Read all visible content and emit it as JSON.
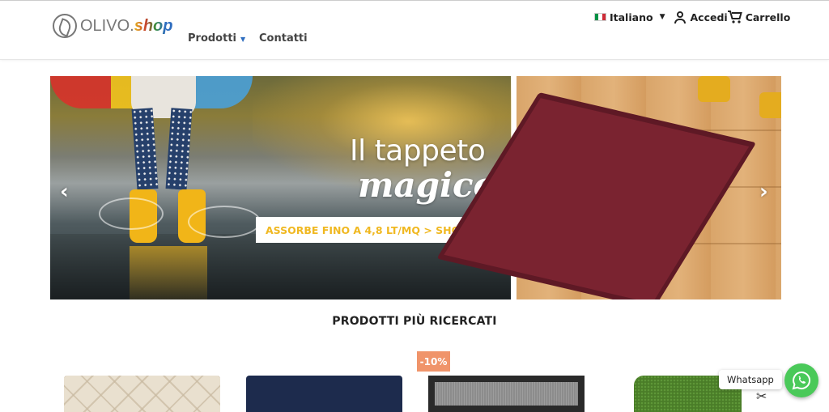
{
  "header": {
    "logo": {
      "text_main": "OLIVO.",
      "text_accent": "shop"
    },
    "nav": [
      {
        "label": "Prodotti",
        "has_dropdown": true
      },
      {
        "label": "Contatti",
        "has_dropdown": false
      }
    ],
    "language": {
      "label": "Italiano",
      "flag": "italy-flag-icon"
    },
    "account_label": "Accedi",
    "cart_label": "Carrello"
  },
  "hero": {
    "title_line1": "Il tappeto",
    "title_line2": "magico",
    "cta": "ASSORBE FINO A 4,8 LT/MQ > SHOP NOW",
    "prev_icon": "chevron-left-icon",
    "next_icon": "chevron-right-icon",
    "colors": {
      "cta_text": "#f0b821",
      "mat": "#7a2330"
    }
  },
  "section": {
    "title": "PRODOTTI PIÙ RICERCATI"
  },
  "products": [
    {
      "badge": ""
    },
    {
      "badge": ""
    },
    {
      "badge": "-10%"
    },
    {
      "badge": ""
    }
  ],
  "whatsapp": {
    "label": "Whatsapp",
    "icon": "whatsapp-icon",
    "color": "#4ac959"
  }
}
